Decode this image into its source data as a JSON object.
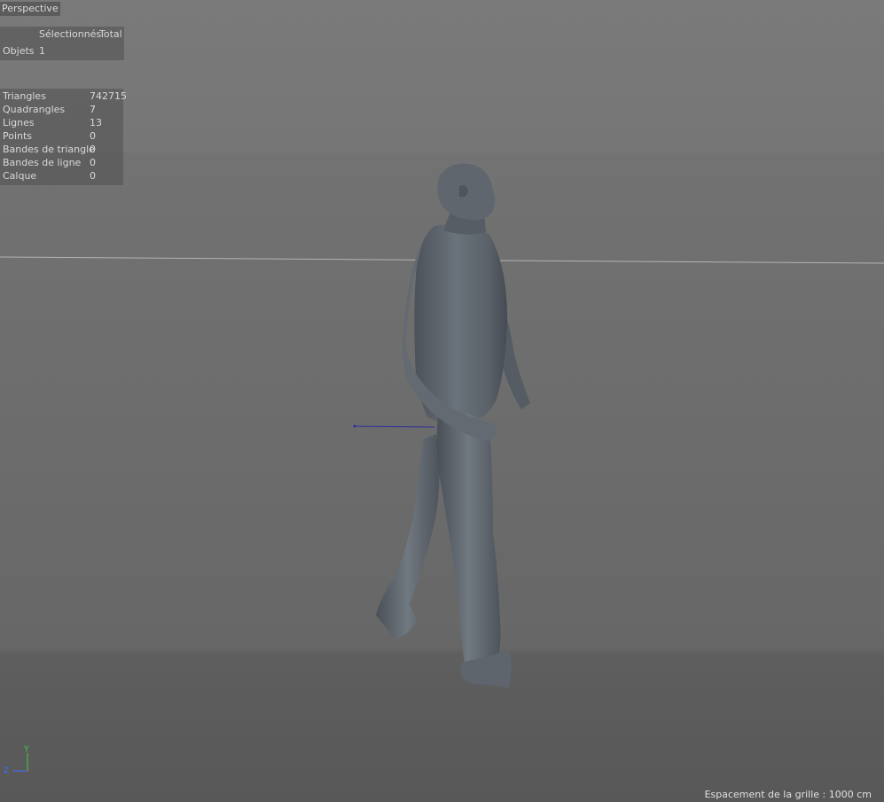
{
  "viewport": {
    "title": "Perspective",
    "grid_spacing": "Espacement de la grille : 1000 cm"
  },
  "hud_objects": {
    "col_selected": "Sélectionnés",
    "col_total": "Total",
    "row_label": "Objets",
    "row_value": "1"
  },
  "hud_stats": [
    {
      "label": "Triangles",
      "value": "742715"
    },
    {
      "label": "Quadrangles",
      "value": "7"
    },
    {
      "label": "Lignes",
      "value": "13"
    },
    {
      "label": "Points",
      "value": "0"
    },
    {
      "label": "Bandes de triangle",
      "value": "0"
    },
    {
      "label": "Bandes de ligne",
      "value": "0"
    },
    {
      "label": "Calque",
      "value": "0"
    }
  ],
  "axis_gizmo": {
    "y_label": "Y",
    "z_label": "Z",
    "y_color": "#3fcf3f",
    "z_color": "#3f6fff",
    "x_color": "#d04040"
  },
  "scene": {
    "object": "human-figure",
    "model_color": "#5a6169",
    "horizon_color": "#b4b4b4",
    "axis_line_color": "#2a2aa0"
  }
}
